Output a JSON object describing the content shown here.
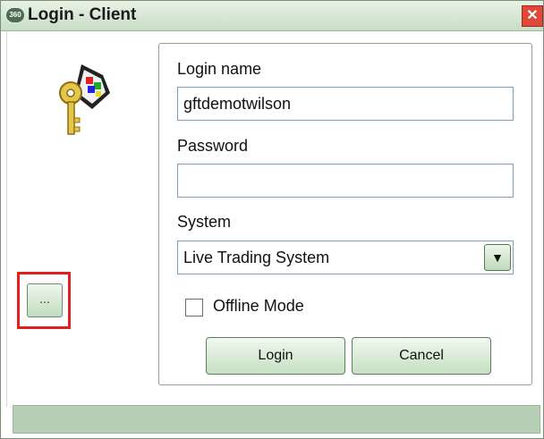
{
  "window": {
    "title": "Login - Client",
    "logo_text": "360",
    "close_glyph": "✕"
  },
  "icons": {
    "keys": "keys-icon"
  },
  "side": {
    "dots_label": "..."
  },
  "form": {
    "login_name_label": "Login name",
    "login_name_value": "gftdemotwilson",
    "password_label": "Password",
    "password_value": "",
    "system_label": "System",
    "system_value": "Live Trading System",
    "offline_label": "Offline Mode",
    "offline_checked": false,
    "login_button": "Login",
    "cancel_button": "Cancel"
  },
  "colors": {
    "titlebar": "#d2e4cf",
    "close": "#e0483a",
    "highlight": "#e02020",
    "statusbar": "#b6cfb6"
  }
}
